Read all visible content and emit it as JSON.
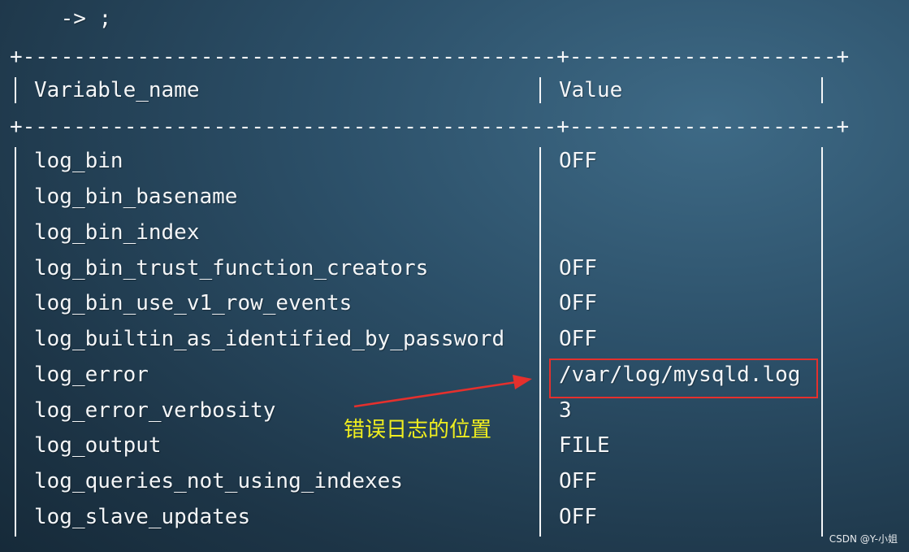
{
  "prompt_continuation": "    -> ;",
  "table": {
    "separator": "+------------------------------------------+---------------------+",
    "headers": [
      "Variable_name",
      "Value"
    ],
    "rows": [
      {
        "name": "log_bin",
        "value": "OFF"
      },
      {
        "name": "log_bin_basename",
        "value": ""
      },
      {
        "name": "log_bin_index",
        "value": ""
      },
      {
        "name": "log_bin_trust_function_creators",
        "value": "OFF"
      },
      {
        "name": "log_bin_use_v1_row_events",
        "value": "OFF"
      },
      {
        "name": "log_builtin_as_identified_by_password",
        "value": "OFF"
      },
      {
        "name": "log_error",
        "value": "/var/log/mysqld.log"
      },
      {
        "name": "log_error_verbosity",
        "value": "3"
      },
      {
        "name": "log_output",
        "value": "FILE"
      },
      {
        "name": "log_queries_not_using_indexes",
        "value": "OFF"
      },
      {
        "name": "log_slave_updates",
        "value": "OFF"
      }
    ]
  },
  "annotation": {
    "text": "错误日志的位置",
    "color": "#f0ee1f",
    "highlight_color": "#e5302d"
  },
  "watermark": "CSDN @Y-小姐"
}
